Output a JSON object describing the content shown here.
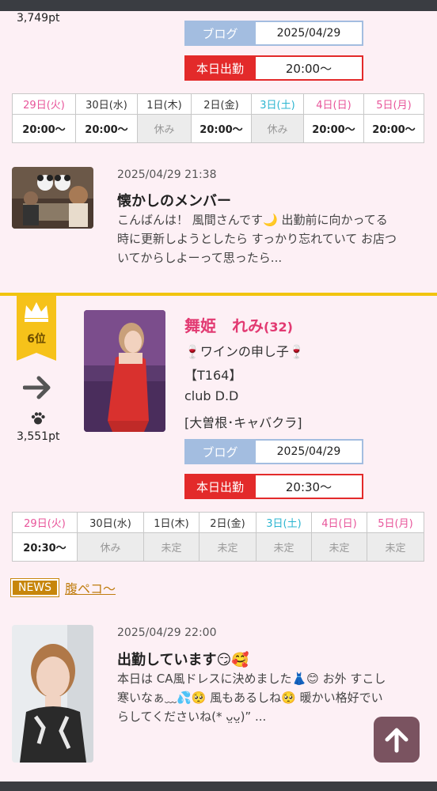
{
  "first_card": {
    "points": "3,749pt",
    "blog": {
      "label": "ブログ",
      "date": "2025/04/29"
    },
    "work": {
      "label": "本日出勤",
      "time": "20:00〜"
    },
    "schedule": {
      "days": [
        "29日(火)",
        "30日(水)",
        "1日(木)",
        "2日(金)",
        "3日(土)",
        "4日(日)",
        "5日(月)"
      ],
      "times": [
        "20:00〜",
        "20:00〜",
        "休み",
        "20:00〜",
        "休み",
        "20:00〜",
        "20:00〜"
      ]
    },
    "post": {
      "date": "2025/04/29 21:38",
      "title": "懐かしのメンバー",
      "lines": [
        "こんばんは！ 風間さんです🌙 出勤前に向かってる",
        "時に更新しようとしたら すっかり忘れていて お店つ",
        "いてからしよーって思ったら..."
      ]
    }
  },
  "second_card": {
    "rank": "6位",
    "trend_icon": "arrow-right-icon",
    "paw_icon": "paw-icon",
    "points": "3,551pt",
    "name": "舞姫　れみ",
    "age": "(32)",
    "tagline": "🍷ワインの申し子🍷",
    "height": "【T164】",
    "club": "club D.D",
    "area": "[大曽根･キャバクラ]",
    "blog": {
      "label": "ブログ",
      "date": "2025/04/29"
    },
    "work": {
      "label": "本日出勤",
      "time": "20:30〜"
    },
    "schedule": {
      "days": [
        "29日(火)",
        "30日(水)",
        "1日(木)",
        "2日(金)",
        "3日(土)",
        "4日(日)",
        "5日(月)"
      ],
      "times": [
        "20:30〜",
        "休み",
        "未定",
        "未定",
        "未定",
        "未定",
        "未定"
      ]
    },
    "news": {
      "badge": "NEWS",
      "link": "腹ペコ〜"
    },
    "post": {
      "date": "2025/04/29 22:00",
      "title": "出勤しています😏🥰",
      "lines": [
        "本日は CA風ドレスに決めました👗😊 お外 すこし",
        "寒いなぁ﹏💦🥺 風もあるしね🥺 暖かい格好でい",
        "らしてくださいね(* ᴗ̤ᴗ̤)” ..."
      ]
    }
  },
  "colors": {
    "accent_pink": "#e8549a",
    "saturday_blue": "#2bb5d0",
    "blog_blue": "#a3bde0",
    "work_red": "#e32a2a",
    "rank_gold": "#f6c21a"
  },
  "back_to_top_icon": "arrow-up-icon"
}
